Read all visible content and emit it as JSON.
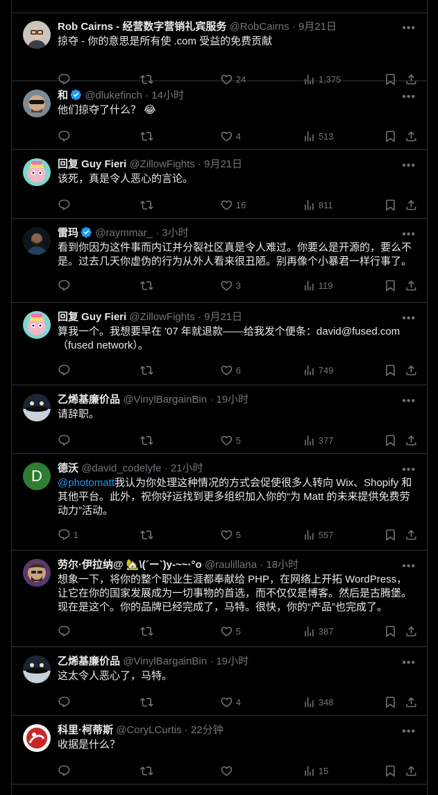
{
  "tweets": [
    {
      "name": "Rob Cairns - 经营数字营销礼宾服务",
      "handle": "@RobCairns",
      "sep": " · ",
      "time": "9月21日",
      "verified": false,
      "text": "掠夺 - 你的意思是所有使 .com 受益的免费贡献",
      "replies": "",
      "retweets": "",
      "likes": "24",
      "views": "1,375",
      "avatar": "rob"
    },
    {
      "name": "和",
      "handle": "@dlukefinch",
      "sep": " · ",
      "time": "14小时",
      "verified": true,
      "text": "他们掠夺了什么？ 😂",
      "replies": "",
      "retweets": "",
      "likes": "4",
      "views": "513",
      "avatar": "luke"
    },
    {
      "name": "回复 Guy Fieri",
      "handle": "@ZillowFights",
      "sep": " · ",
      "time": "9月21日",
      "verified": false,
      "text": "该死，真是令人恶心的言论。",
      "replies": "",
      "retweets": "",
      "likes": "16",
      "views": "811",
      "avatar": "guy"
    },
    {
      "name": "雷玛",
      "handle": "@raymmar_",
      "sep": " · ",
      "time": "3小时",
      "verified": true,
      "text": "看到你因为这件事而内讧并分裂社区真是令人难过。你要么是开源的，要么不是。过去几天你虚伪的行为从外人看来很丑陋。别再像个小暴君一样行事了。",
      "replies": "",
      "retweets": "",
      "likes": "3",
      "views": "119",
      "avatar": "ray"
    },
    {
      "name": "回复 Guy Fieri",
      "handle": "@ZillowFights",
      "sep": " · ",
      "time": "9月21日",
      "verified": false,
      "text": "算我一个。我想要早在 '07 年就退款——给我发个便条：david@fused.com （fused network）。",
      "replies": "",
      "retweets": "",
      "likes": "6",
      "views": "749",
      "avatar": "guy"
    },
    {
      "name": "乙烯基廉价品",
      "handle": "@VinylBargainBin",
      "sep": " · ",
      "time": "19小时",
      "verified": false,
      "text": "请辞职。",
      "replies": "",
      "retweets": "",
      "likes": "5",
      "views": "377",
      "avatar": "vinyl"
    },
    {
      "name": "德沃",
      "handle": "@david_codelyfe",
      "sep": " · ",
      "time": "21小时",
      "verified": false,
      "mention": "@photomatt",
      "text": "我认为你处理这种情况的方式会促使很多人转向 Wix、Shopify 和其他平台。此外，祝你好运找到更多组织加入你的“为 Matt 的未来提供免费劳动力”活动。",
      "replies": "1",
      "retweets": "",
      "likes": "5",
      "views": "557",
      "avatar": "d",
      "avatar_letter": "D"
    },
    {
      "name": "劳尔·伊拉纳@ 🏡\\(´ー`)y-~~·°o",
      "handle": "@raulillana",
      "sep": " · ",
      "time": "18小时",
      "verified": false,
      "text": "想象一下，将你的整个职业生涯都奉献给 PHP，在网络上开拓 WordPress，让它在你的国家发展成为一切事物的首选，而不仅仅是博客。然后是古腾堡。现在是这个。你的品牌已经完成了，马特。很快，你的“产品”也完成了。",
      "replies": "",
      "retweets": "",
      "likes": "5",
      "views": "387",
      "avatar": "raul"
    },
    {
      "name": "乙烯基廉价品",
      "handle": "@VinylBargainBin",
      "sep": " · ",
      "time": "19小时",
      "verified": false,
      "text": "这太令人恶心了，马特。",
      "replies": "",
      "retweets": "",
      "likes": "4",
      "views": "348",
      "avatar": "vinyl"
    },
    {
      "name": "科里·柯蒂斯",
      "handle": "@CoryLCurtis",
      "sep": " · ",
      "time": "22分钟",
      "verified": false,
      "text": "收据是什么？",
      "replies": "",
      "retweets": "",
      "likes": "",
      "views": "15",
      "avatar": "cory"
    }
  ],
  "icons": {
    "reply": "reply-icon",
    "retweet": "retweet-icon",
    "like": "heart-icon",
    "views": "views-icon",
    "bookmark": "bookmark-icon",
    "share": "share-icon",
    "more": "more-icon",
    "verified": "verified-badge-icon"
  },
  "colors": {
    "background": "#000000",
    "text": "#e7e9ea",
    "muted": "#71767b",
    "link": "#1d9bf0",
    "border": "#2f3336",
    "verified": "#1d9bf0"
  }
}
